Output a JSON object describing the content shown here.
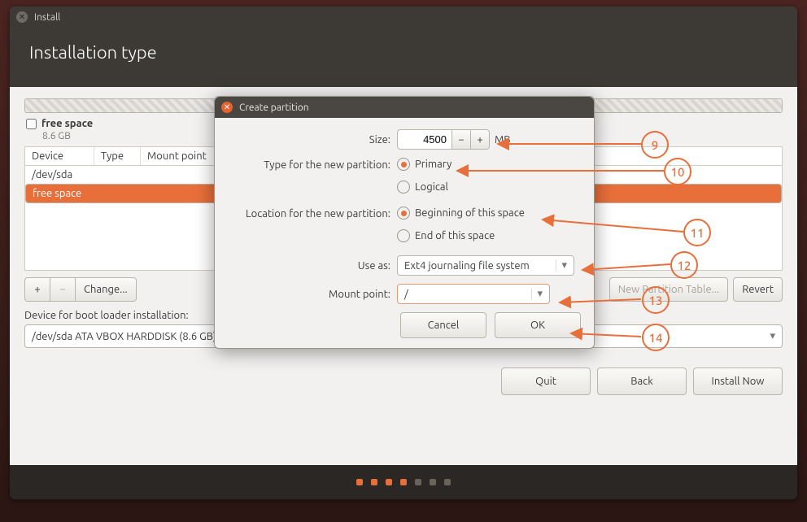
{
  "window_title": "Install",
  "page_title": "Installation type",
  "diskbar": {
    "first_name": "free space",
    "first_size": "8.6 GB"
  },
  "columns": {
    "device": "Device",
    "type": "Type",
    "mount": "Mount point"
  },
  "rows": {
    "r0": "/dev/sda",
    "r1": "free space"
  },
  "toolbar": {
    "plus": "+",
    "minus": "−",
    "change": "Change...",
    "newtable": "New Partition Table...",
    "revert": "Revert"
  },
  "boot": {
    "label": "Device for boot loader installation:",
    "value": "/dev/sda   ATA VBOX HARDDISK (8.6 GB)"
  },
  "footer": {
    "quit": "Quit",
    "back": "Back",
    "install": "Install Now"
  },
  "modal": {
    "title": "Create partition",
    "size_label": "Size:",
    "size_value": "4500",
    "size_unit": "MB",
    "type_label": "Type for the new partition:",
    "type_primary": "Primary",
    "type_logical": "Logical",
    "loc_label": "Location for the new partition:",
    "loc_begin": "Beginning of this space",
    "loc_end": "End of this space",
    "useas_label": "Use as:",
    "useas_value": "Ext4 journaling file system",
    "mount_label": "Mount point:",
    "mount_value": "/",
    "cancel": "Cancel",
    "ok": "OK"
  },
  "callouts": {
    "c9": "9",
    "c10": "10",
    "c11": "11",
    "c12": "12",
    "c13": "13",
    "c14": "14"
  }
}
